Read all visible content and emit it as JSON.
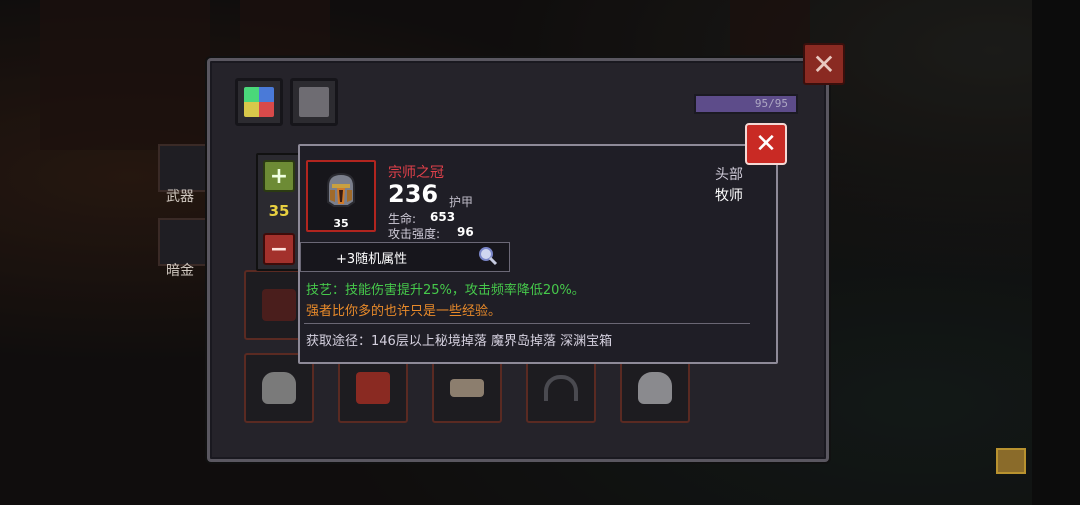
{
  "panel": {
    "xp_text": "95/95",
    "close_symbol": "✕"
  },
  "sidebar": {
    "weapon_label": "武器",
    "gold_label": "暗金"
  },
  "quantity": {
    "value": "35",
    "plus_symbol": "+",
    "minus_symbol": "−"
  },
  "item": {
    "name": "宗师之冠",
    "armor_value": "236",
    "armor_label": "护甲",
    "level": "35",
    "slot_type": "头部",
    "class_name": "牧师",
    "stats": [
      {
        "name": "生命:",
        "value": "653"
      },
      {
        "name": "攻击强度:",
        "value": "96"
      }
    ],
    "random_attr": "+3随机属性",
    "skill": "技艺：技能伤害提升25%，攻击频率降低20%。",
    "flavor": "强者比你多的也许只是一些经验。",
    "source": "获取途径：146层以上秘境掉落 魔界岛掉落 深渊宝箱"
  },
  "tooltip": {
    "close_symbol": "✕"
  },
  "colors": {
    "rarity_red": "#e0404a",
    "skill_green": "#46c94b",
    "flavor_orange": "#e88a2a",
    "level_yellow": "#e8d040"
  },
  "icons": {
    "tabs": [
      "color-grid-icon",
      "skull-helmet-icon"
    ],
    "gear_slots": [
      "skull-icon",
      "red-mask-icon",
      "bone-boot-icon",
      "headphones-icon",
      "skull-helmet-icon"
    ]
  }
}
